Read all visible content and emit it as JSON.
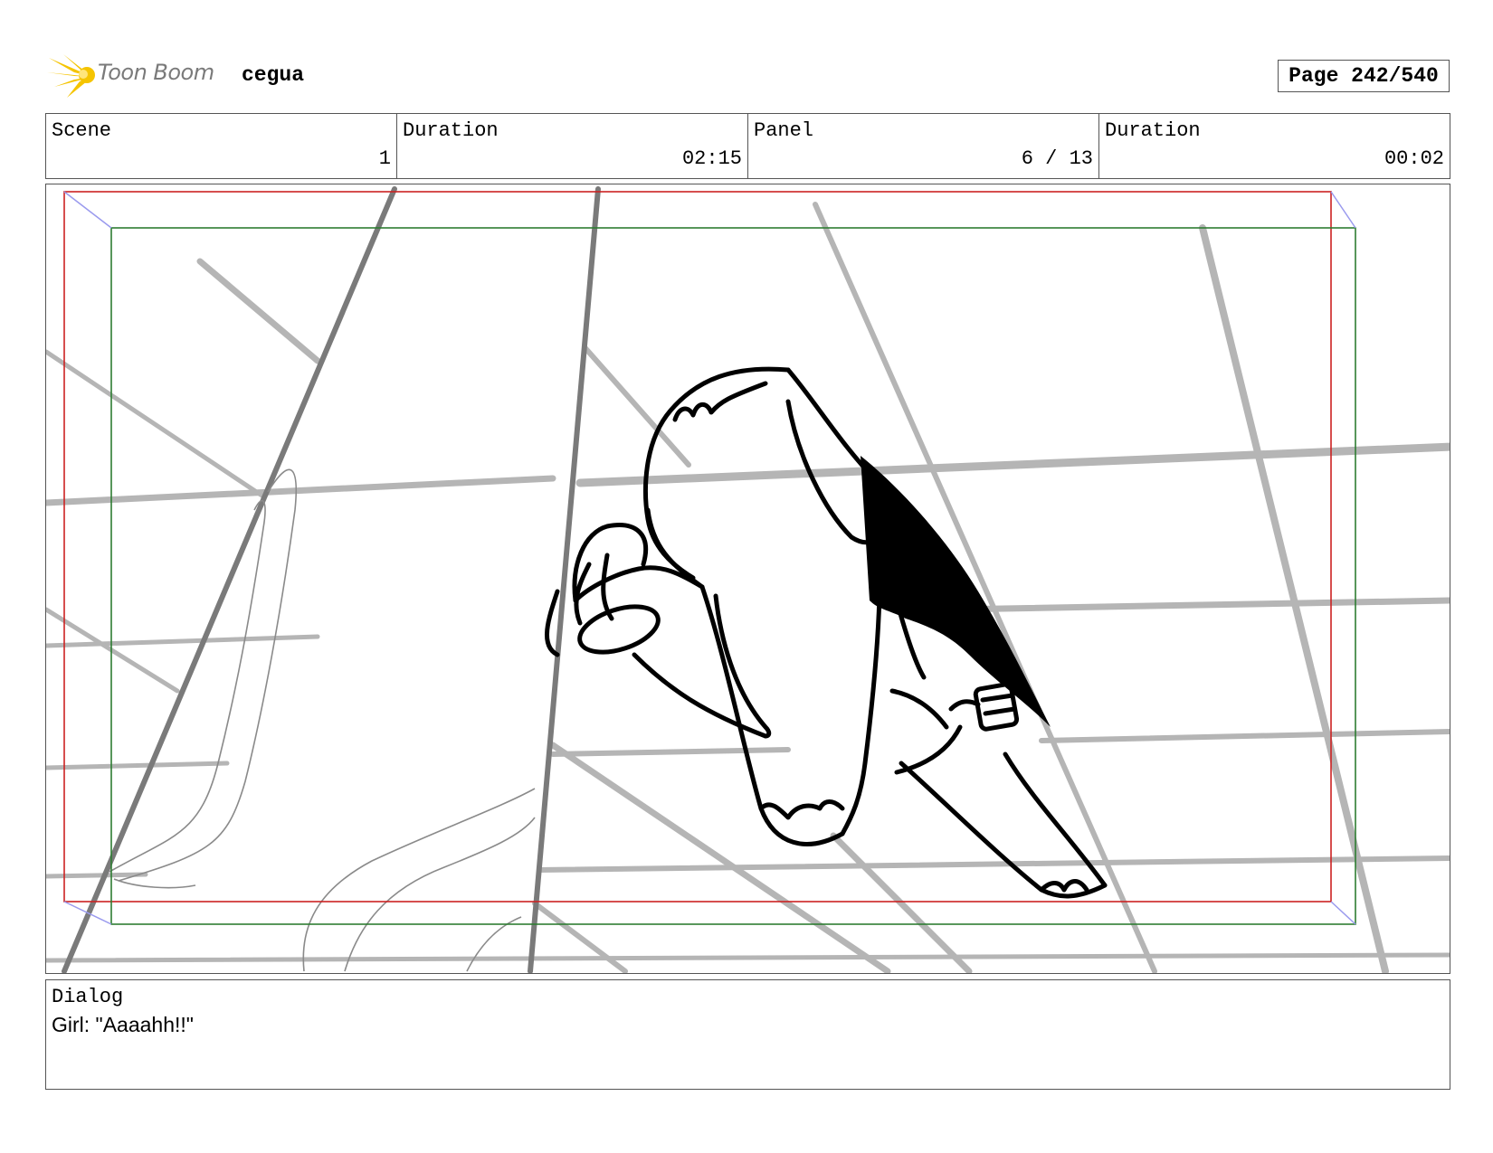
{
  "header": {
    "logo_text": "Toon Boom",
    "project_name": "cegua",
    "page_label": "Page 242/540"
  },
  "info": [
    {
      "label": "Scene",
      "value": "1"
    },
    {
      "label": "Duration",
      "value": "02:15"
    },
    {
      "label": "Panel",
      "value": "6 / 13"
    },
    {
      "label": "Duration",
      "value": "00:02"
    }
  ],
  "dialog": {
    "label": "Dialog",
    "text": "Girl: \"Aaaahh!!\""
  },
  "colors": {
    "safe_frame": "#cc2222",
    "action_frame": "#2e7d32",
    "logo_star": "#f5c400"
  }
}
